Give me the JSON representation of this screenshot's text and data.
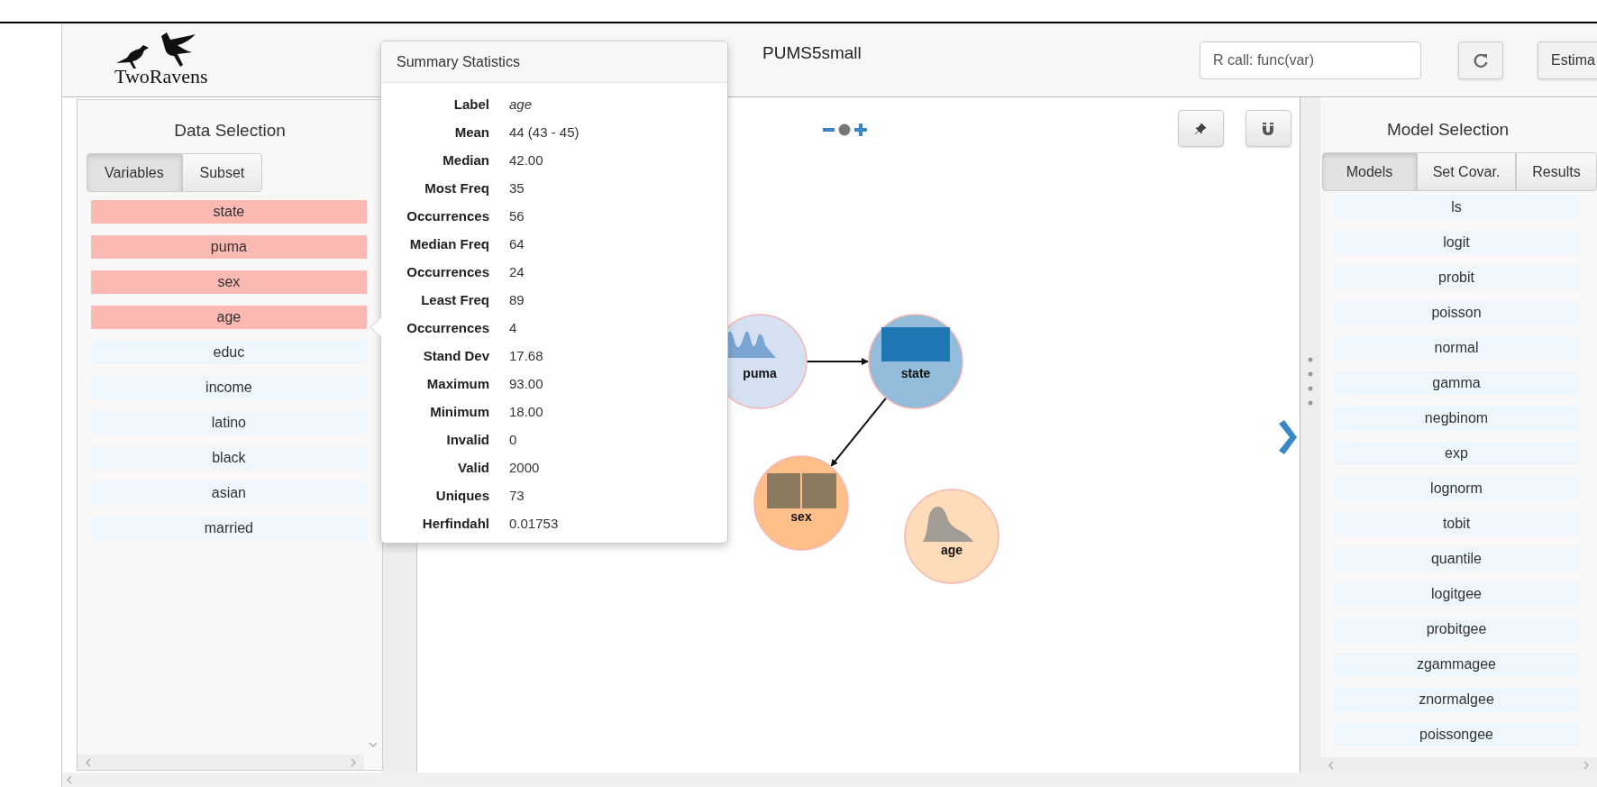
{
  "header": {
    "logo": "TwoRavens",
    "title": "PUMS5small",
    "rcall_field": {
      "placeholder": "R call: func(var)"
    },
    "estimate_button": "Estima"
  },
  "data_panel": {
    "title": "Data Selection",
    "tabs": [
      {
        "label": "Variables",
        "selected": true
      },
      {
        "label": "Subset",
        "selected": false
      }
    ],
    "variables": [
      {
        "name": "state",
        "selected": true
      },
      {
        "name": "puma",
        "selected": true
      },
      {
        "name": "sex",
        "selected": true
      },
      {
        "name": "age",
        "selected": true
      },
      {
        "name": "educ",
        "selected": false
      },
      {
        "name": "income",
        "selected": false
      },
      {
        "name": "latino",
        "selected": false
      },
      {
        "name": "black",
        "selected": false
      },
      {
        "name": "asian",
        "selected": false
      },
      {
        "name": "married",
        "selected": false
      }
    ]
  },
  "summary_popover": {
    "title": "Summary Statistics",
    "rows": [
      {
        "label": "Label",
        "value": "age",
        "kind": "italic"
      },
      {
        "label": "Mean",
        "value": "44 (43 - 45)",
        "kind": "plain"
      },
      {
        "label": "Median",
        "value": "42.00",
        "kind": "plain"
      },
      {
        "label": "Most Freq",
        "value": "35",
        "kind": "plain"
      },
      {
        "label": "Occurrences",
        "value": "56",
        "kind": "plain"
      },
      {
        "label": "Median Freq",
        "value": "64",
        "kind": "plain"
      },
      {
        "label": "Occurrences",
        "value": "24",
        "kind": "plain"
      },
      {
        "label": "Least Freq",
        "value": "89",
        "kind": "plain"
      },
      {
        "label": "Occurrences",
        "value": "4",
        "kind": "plain"
      },
      {
        "label": "Stand Dev",
        "value": "17.68",
        "kind": "plain"
      },
      {
        "label": "Maximum",
        "value": "93.00",
        "kind": "plain"
      },
      {
        "label": "Minimum",
        "value": "18.00",
        "kind": "plain"
      },
      {
        "label": "Invalid",
        "value": "0",
        "kind": "plain"
      },
      {
        "label": "Valid",
        "value": "2000",
        "kind": "plain"
      },
      {
        "label": "Uniques",
        "value": "73",
        "kind": "plain"
      },
      {
        "label": "Herfindahl",
        "value": "0.01753",
        "kind": "plain"
      }
    ]
  },
  "graph": {
    "nodes": [
      {
        "label": "puma",
        "color": "#d5e1f2",
        "kind": "wavy"
      },
      {
        "label": "state",
        "color": "#93bcdb",
        "kind": "block"
      },
      {
        "label": "sex",
        "color": "#ffbf88",
        "kind": "split"
      },
      {
        "label": "age",
        "color": "#fedbb9",
        "kind": "skewed"
      }
    ]
  },
  "model_panel": {
    "title": "Model Selection",
    "tabs": [
      {
        "label": "Models",
        "selected": true
      },
      {
        "label": "Set Covar.",
        "selected": false
      },
      {
        "label": "Results",
        "selected": false
      }
    ],
    "models": [
      {
        "name": "ls",
        "selected": false
      },
      {
        "name": "logit",
        "selected": false
      },
      {
        "name": "probit",
        "selected": false
      },
      {
        "name": "poisson",
        "selected": false
      },
      {
        "name": "normal",
        "selected": false
      },
      {
        "name": "gamma",
        "selected": false
      },
      {
        "name": "negbinom",
        "selected": false
      },
      {
        "name": "exp",
        "selected": false
      },
      {
        "name": "lognorm",
        "selected": false
      },
      {
        "name": "tobit",
        "selected": false
      },
      {
        "name": "quantile",
        "selected": false
      },
      {
        "name": "logitgee",
        "selected": false
      },
      {
        "name": "probitgee",
        "selected": false
      },
      {
        "name": "zgammagee",
        "selected": false
      },
      {
        "name": "znormalgee",
        "selected": false
      },
      {
        "name": "poissongee",
        "selected": false
      }
    ]
  }
}
